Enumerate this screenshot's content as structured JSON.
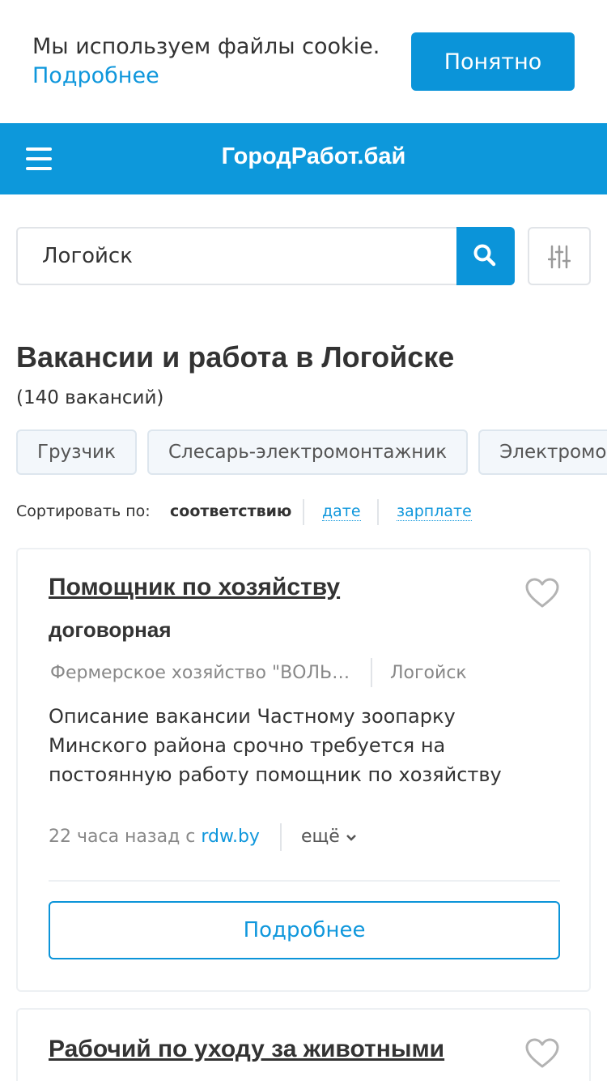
{
  "cookie": {
    "text": "Мы используем файлы cookie.",
    "link": "Подробнее",
    "button": "Понятно"
  },
  "header": {
    "menu_icon": "hamburger-menu-icon",
    "logo": "ГородРабот.бай"
  },
  "search": {
    "value": "Логойск",
    "search_icon": "search-icon",
    "filter_icon": "filter-sliders-icon"
  },
  "page": {
    "title": "Вакансии и работа в Логойске",
    "count": "(140 вакансий)"
  },
  "chips": [
    "Грузчик",
    "Слесарь-электромонтажник",
    "Электромонтер"
  ],
  "sort": {
    "label": "Сортировать по:",
    "active": "соответствию",
    "options": [
      "дате",
      "зарплате"
    ]
  },
  "jobs": [
    {
      "title": "Помощник по хозяйству",
      "salary": "договорная",
      "company": "Фермерское хозяйство \"ВОЛЬНАЯ ЗЕМЛЯ\"",
      "city": "Логойск",
      "description": "Описание вакансии Частному зоопарку Минского района срочно требуется на постоянную работу помощник по хозяйству",
      "time": "22 часа назад с ",
      "source": "rdw.by",
      "more": "ещё",
      "button": "Подробнее"
    },
    {
      "title": "Рабочий по уходу за животными"
    }
  ],
  "colors": {
    "brand": "#0d98db",
    "link": "#0f97dc"
  }
}
